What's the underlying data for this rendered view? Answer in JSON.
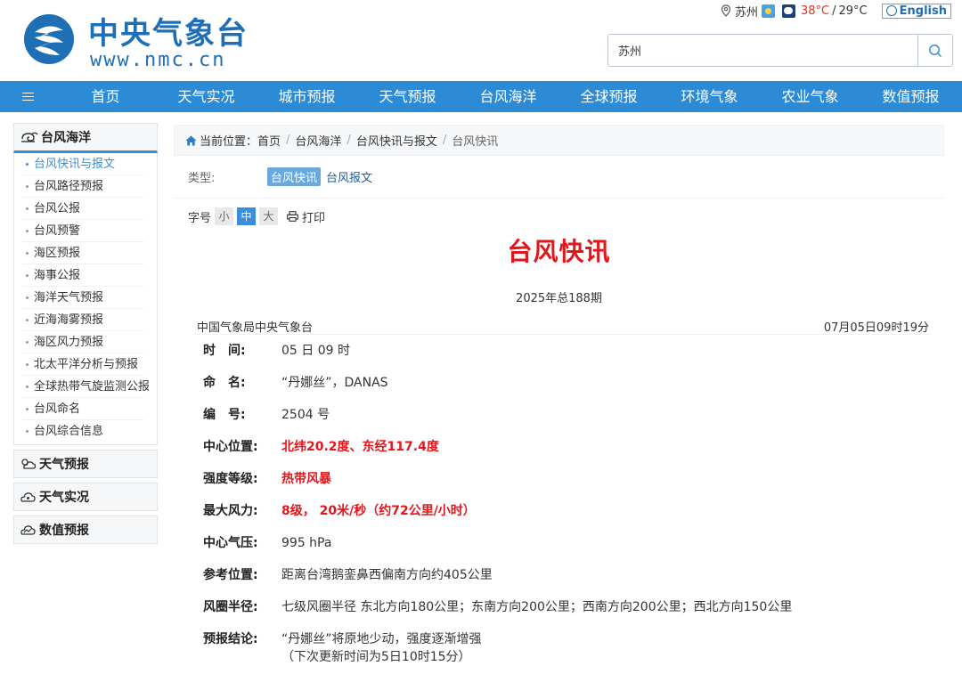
{
  "header": {
    "logo_cn": "中央气象台",
    "logo_en": "www.nmc.cn",
    "city": "苏州",
    "temp_high": "38°C",
    "temp_sep": "/",
    "temp_low": "29°C",
    "lang_label": "English",
    "search": {
      "value": "苏州"
    }
  },
  "nav": {
    "items": [
      "首页",
      "天气实况",
      "城市预报",
      "天气预报",
      "台风海洋",
      "全球预报",
      "环境气象",
      "农业气象",
      "数值预报"
    ]
  },
  "sidebar": {
    "title": "台风海洋",
    "items": [
      "台风快讯与报文",
      "台风路径预报",
      "台风公报",
      "台风预警",
      "海区预报",
      "海事公报",
      "海洋天气预报",
      "近海海雾预报",
      "海区风力预报",
      "北太平洋分析与预报",
      "全球热带气旋监测公报",
      "台风命名",
      "台风综合信息"
    ],
    "groups": [
      "天气预报",
      "天气实况",
      "数值预报"
    ]
  },
  "breadcrumb": {
    "prefix": "当前位置：",
    "items": [
      "首页",
      "台风海洋",
      "台风快讯与报文",
      "台风快讯"
    ]
  },
  "types": {
    "label": "类型:",
    "active": "台风快讯",
    "other": "台风报文"
  },
  "tools": {
    "font_label": "字号",
    "small": "小",
    "medium": "中",
    "large": "大",
    "print": "打印"
  },
  "article": {
    "title": "台风快讯",
    "issue": "2025年总188期",
    "agency": "中国气象局中央气象台",
    "time": "07月05日09时19分",
    "rows": [
      {
        "key": "时　间:",
        "value": "05 日 09 时"
      },
      {
        "key": "命　名:",
        "value": "“丹娜丝”，DANAS"
      },
      {
        "key": "编　号:",
        "value": "2504 号"
      },
      {
        "key": "中心位置:",
        "value": "北纬20.2度、东经117.4度"
      },
      {
        "key": "强度等级:",
        "value": "热带风暴"
      },
      {
        "key": "最大风力:",
        "value": "8级， 20米/秒（约72公里/小时）"
      },
      {
        "key": "中心气压:",
        "value": "995 hPa"
      },
      {
        "key": "参考位置:",
        "value": "距离台湾鹅銮鼻西偏南方向约405公里"
      },
      {
        "key": "风圈半径:",
        "value": "七级风圈半径 东北方向180公里；东南方向200公里；西南方向200公里；西北方向150公里"
      },
      {
        "key": "预报结论:",
        "value": "“丹娜丝”将原地少动，强度逐渐增强",
        "value2": "（下次更新时间为5日10时15分）"
      }
    ]
  },
  "colors": {
    "accent": "#2d8bd6",
    "title_red": "#e0171c"
  }
}
